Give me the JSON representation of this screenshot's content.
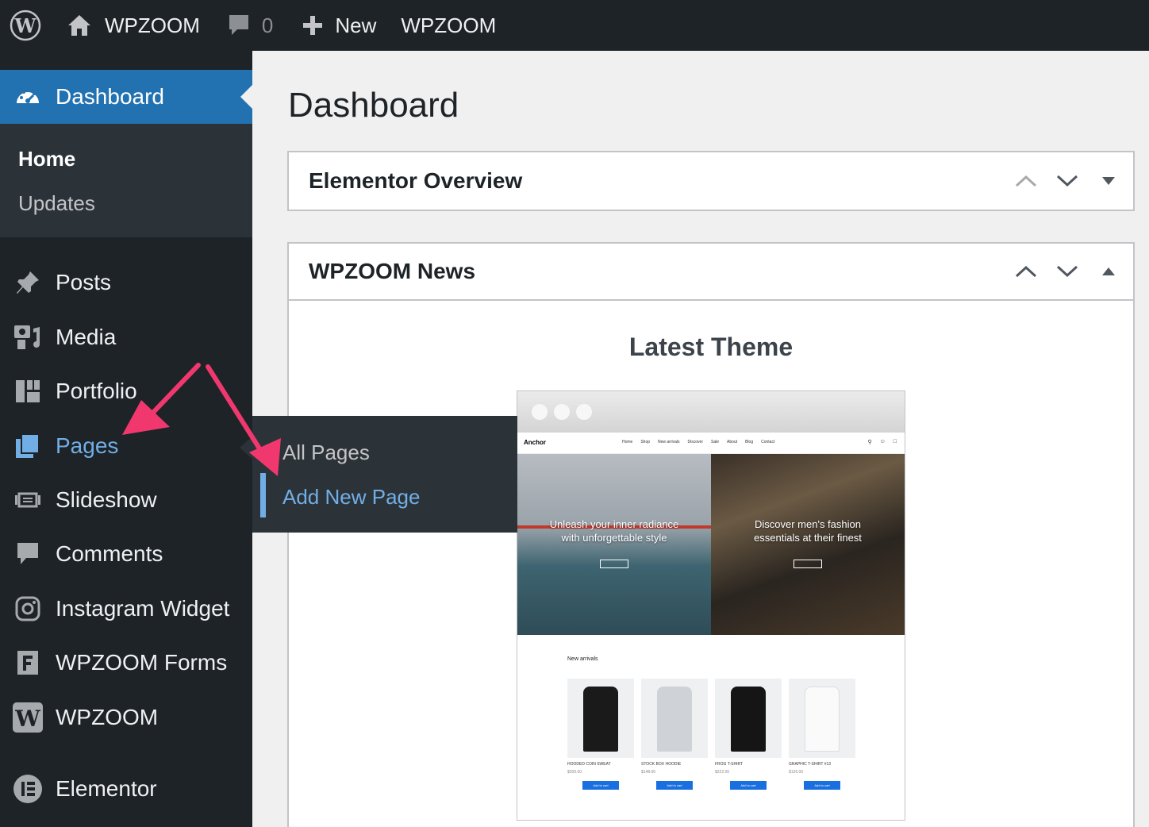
{
  "admin_bar": {
    "site_name": "WPZOOM",
    "comments_count": "0",
    "new_label": "New",
    "extra_item": "WPZOOM"
  },
  "sidebar": {
    "dashboard": "Dashboard",
    "submenu": {
      "home": "Home",
      "updates": "Updates"
    },
    "items": [
      {
        "label": "Posts",
        "icon": "pin-icon"
      },
      {
        "label": "Media",
        "icon": "media-icon"
      },
      {
        "label": "Portfolio",
        "icon": "portfolio-icon"
      },
      {
        "label": "Pages",
        "icon": "pages-icon"
      },
      {
        "label": "Slideshow",
        "icon": "slideshow-icon"
      },
      {
        "label": "Comments",
        "icon": "comment-icon"
      },
      {
        "label": "Instagram Widget",
        "icon": "instagram-icon"
      },
      {
        "label": "WPZOOM Forms",
        "icon": "forms-icon"
      },
      {
        "label": "WPZOOM",
        "icon": "wpzoom-icon"
      },
      {
        "label": "Elementor",
        "icon": "elementor-icon"
      }
    ]
  },
  "flyout": {
    "all_pages": "All Pages",
    "add_new_page": "Add New Page"
  },
  "main": {
    "title": "Dashboard",
    "widget1_title": "Elementor Overview",
    "widget2_title": "WPZOOM News",
    "latest_theme": "Latest Theme"
  },
  "preview": {
    "logo": "Anchor",
    "nav": [
      "Home",
      "Shop",
      "New arrivals",
      "Discover",
      "Sale",
      "About",
      "Blog",
      "Contact"
    ],
    "hero_left_line1": "Unleash your inner radiance",
    "hero_left_line2": "with unforgettable style",
    "hero_right_line1": "Discover men's fashion",
    "hero_right_line2": "essentials at their finest",
    "section_title": "New arrivals",
    "products": [
      {
        "name": "HOODED COIN SWEAT",
        "price": "$200.00",
        "cart": "Add to cart"
      },
      {
        "name": "STOCK BOX HOODIE",
        "price": "$148.00",
        "cart": "Add to cart"
      },
      {
        "name": "FROG T-SHIRT",
        "price": "$222.00",
        "cart": "Add to cart"
      },
      {
        "name": "GRAPHIC T-SHIRT #13",
        "price": "$126.00",
        "cart": "Add to cart"
      }
    ]
  },
  "colors": {
    "admin_bar_bg": "#1d2327",
    "sidebar_bg": "#1d2327",
    "submenu_bg": "#2c3338",
    "accent_blue": "#2271b1",
    "link_blue": "#72aee6",
    "arrow_pink": "#f0386e"
  }
}
